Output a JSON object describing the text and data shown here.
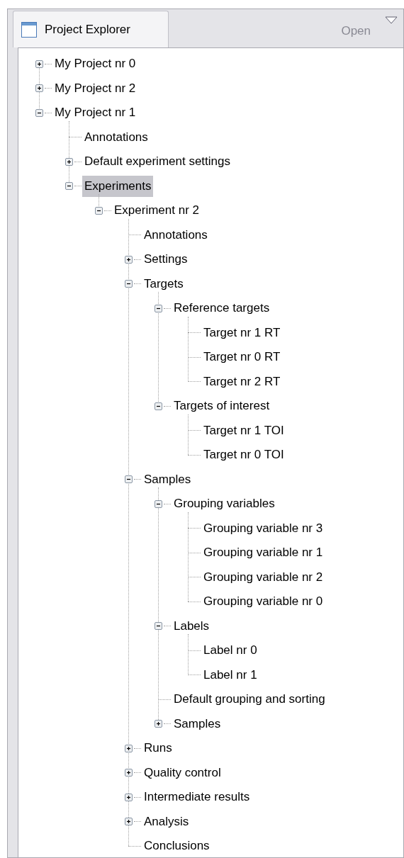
{
  "tab": {
    "title": "Project Explorer"
  },
  "toolbar": {
    "open_label": "Open",
    "open_disabled": true
  },
  "tree": [
    {
      "label": "My Project nr 0",
      "kind": "folder",
      "expanded": false,
      "selected": false
    },
    {
      "label": "My Project nr 2",
      "kind": "folder",
      "expanded": false,
      "selected": false
    },
    {
      "label": "My Project nr 1",
      "kind": "folder",
      "expanded": true,
      "selected": false,
      "children": [
        {
          "label": "Annotations",
          "kind": "leaf",
          "selected": false
        },
        {
          "label": "Default experiment settings",
          "kind": "folder",
          "expanded": false,
          "selected": false
        },
        {
          "label": "Experiments",
          "kind": "folder",
          "expanded": true,
          "selected": true,
          "children": [
            {
              "label": "Experiment nr 2",
              "kind": "folder",
              "expanded": true,
              "selected": false,
              "children": [
                {
                  "label": "Annotations",
                  "kind": "leaf",
                  "selected": false
                },
                {
                  "label": "Settings",
                  "kind": "folder",
                  "expanded": false,
                  "selected": false
                },
                {
                  "label": "Targets",
                  "kind": "folder",
                  "expanded": true,
                  "selected": false,
                  "children": [
                    {
                      "label": "Reference targets",
                      "kind": "folder",
                      "expanded": true,
                      "selected": false,
                      "children": [
                        {
                          "label": "Target nr 1 RT",
                          "kind": "leaf",
                          "selected": false
                        },
                        {
                          "label": "Target nr 0 RT",
                          "kind": "leaf",
                          "selected": false
                        },
                        {
                          "label": "Target nr 2 RT",
                          "kind": "leaf",
                          "selected": false
                        }
                      ]
                    },
                    {
                      "label": "Targets of interest",
                      "kind": "folder",
                      "expanded": true,
                      "selected": false,
                      "children": [
                        {
                          "label": "Target nr 1 TOI",
                          "kind": "leaf",
                          "selected": false
                        },
                        {
                          "label": "Target nr 0 TOI",
                          "kind": "leaf",
                          "selected": false
                        }
                      ]
                    }
                  ]
                },
                {
                  "label": "Samples",
                  "kind": "folder",
                  "expanded": true,
                  "selected": false,
                  "children": [
                    {
                      "label": "Grouping variables",
                      "kind": "folder",
                      "expanded": true,
                      "selected": false,
                      "children": [
                        {
                          "label": "Grouping variable nr 3",
                          "kind": "leaf",
                          "selected": false
                        },
                        {
                          "label": "Grouping variable nr 1",
                          "kind": "leaf",
                          "selected": false
                        },
                        {
                          "label": "Grouping variable nr 2",
                          "kind": "leaf",
                          "selected": false
                        },
                        {
                          "label": "Grouping variable nr 0",
                          "kind": "leaf",
                          "selected": false
                        }
                      ]
                    },
                    {
                      "label": "Labels",
                      "kind": "folder",
                      "expanded": true,
                      "selected": false,
                      "children": [
                        {
                          "label": "Label nr 0",
                          "kind": "leaf",
                          "selected": false
                        },
                        {
                          "label": "Label nr 1",
                          "kind": "leaf",
                          "selected": false
                        }
                      ]
                    },
                    {
                      "label": "Default grouping and sorting",
                      "kind": "leaf",
                      "selected": false
                    },
                    {
                      "label": "Samples",
                      "kind": "folder",
                      "expanded": false,
                      "selected": false
                    }
                  ]
                },
                {
                  "label": "Runs",
                  "kind": "folder",
                  "expanded": false,
                  "selected": false
                },
                {
                  "label": "Quality control",
                  "kind": "folder",
                  "expanded": false,
                  "selected": false
                },
                {
                  "label": "Intermediate results",
                  "kind": "folder",
                  "expanded": false,
                  "selected": false
                },
                {
                  "label": "Analysis",
                  "kind": "folder",
                  "expanded": false,
                  "selected": false
                },
                {
                  "label": "Conclusions",
                  "kind": "leaf",
                  "selected": false
                }
              ]
            }
          ]
        }
      ]
    }
  ]
}
